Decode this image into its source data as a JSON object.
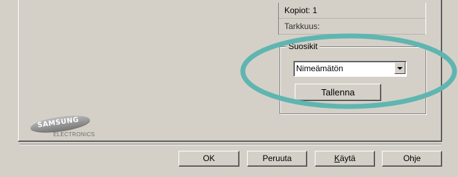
{
  "print_info": {
    "copies": "Kopiot: 1",
    "resolution": "Tarkkuus:"
  },
  "favorites": {
    "group_title": "Suosikit",
    "selected_value": "Nimeämätön",
    "save_label": "Tallenna"
  },
  "brand": {
    "name": "SAMSUNG",
    "sub": "ELECTRONICS"
  },
  "dialog_buttons": {
    "ok": "OK",
    "cancel": "Peruuta",
    "apply_mnemonic": "K",
    "apply_rest": "äytä",
    "help": "Ohje"
  },
  "colors": {
    "face": "#d4d0c8",
    "highlight_ellipse": "#5fb5b0"
  }
}
